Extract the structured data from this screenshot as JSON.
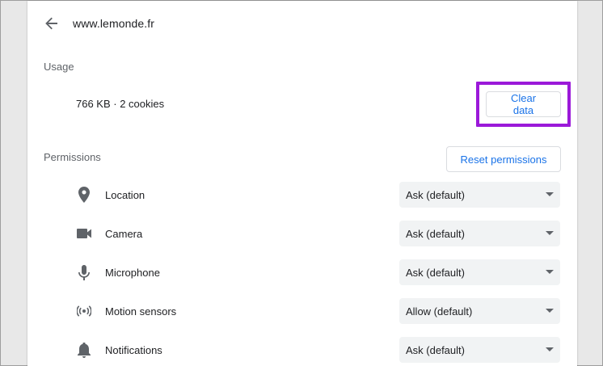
{
  "header": {
    "title": "www.lemonde.fr",
    "back_icon": "arrow-back-icon"
  },
  "usage": {
    "label": "Usage",
    "summary": "766 KB · 2 cookies",
    "clear_label": "Clear data"
  },
  "permissions": {
    "label": "Permissions",
    "reset_label": "Reset permissions",
    "items": [
      {
        "label": "Location",
        "value": "Ask (default)",
        "icon": "location-pin-icon"
      },
      {
        "label": "Camera",
        "value": "Ask (default)",
        "icon": "camera-icon"
      },
      {
        "label": "Microphone",
        "value": "Ask (default)",
        "icon": "microphone-icon"
      },
      {
        "label": "Motion sensors",
        "value": "Allow (default)",
        "icon": "motion-sensors-icon"
      },
      {
        "label": "Notifications",
        "value": "Ask (default)",
        "icon": "bell-icon"
      }
    ]
  },
  "colors": {
    "accent": "#1a73e8",
    "highlight": "#9b19d9",
    "select_bg": "#f1f3f4"
  }
}
